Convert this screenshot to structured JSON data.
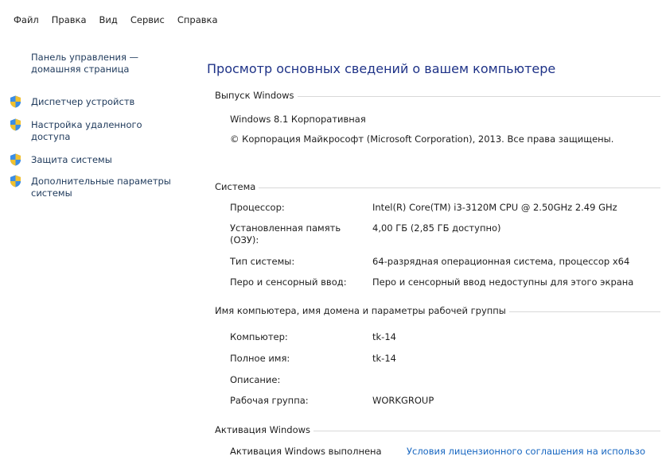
{
  "menu": {
    "items": [
      "Файл",
      "Правка",
      "Вид",
      "Сервис",
      "Справка"
    ]
  },
  "sidebar": {
    "home_link": "Панель управления — домашняя страница",
    "links": [
      {
        "label": "Диспетчер устройств",
        "icon": "uac-shield-icon"
      },
      {
        "label": "Настройка удаленного доступа",
        "icon": "uac-shield-icon"
      },
      {
        "label": "Защита системы",
        "icon": "uac-shield-icon"
      },
      {
        "label": "Дополнительные параметры системы",
        "icon": "uac-shield-icon"
      }
    ]
  },
  "main": {
    "title": "Просмотр основных сведений о вашем компьютере",
    "edition": {
      "header": "Выпуск Windows",
      "name": "Windows 8.1 Корпоративная",
      "copyright": "© Корпорация Майкрософт (Microsoft Corporation), 2013. Все права защищены."
    },
    "system": {
      "header": "Система",
      "rows": [
        {
          "label": "Процессор:",
          "value": "Intel(R) Core(TM) i3-3120M CPU @ 2.50GHz   2.49 GHz"
        },
        {
          "label": "Установленная память (ОЗУ):",
          "value": "4,00 ГБ (2,85 ГБ доступно)"
        },
        {
          "label": "Тип системы:",
          "value": "64-разрядная операционная система, процессор x64"
        },
        {
          "label": "Перо и сенсорный ввод:",
          "value": "Перо и сенсорный ввод недоступны для этого экрана"
        }
      ]
    },
    "computer": {
      "header": "Имя компьютера, имя домена и параметры рабочей группы",
      "rows": [
        {
          "label": "Компьютер:",
          "value": "tk-14"
        },
        {
          "label": "Полное имя:",
          "value": "tk-14"
        },
        {
          "label": "Описание:",
          "value": ""
        },
        {
          "label": "Рабочая группа:",
          "value": "WORKGROUP"
        }
      ]
    },
    "activation": {
      "header": "Активация Windows",
      "status": "Активация Windows выполнена",
      "license_link": "Условия лицензионного соглашения на использо"
    }
  },
  "colors": {
    "link": "#1e395b",
    "title": "#1e3287",
    "hyperlink": "#1565c0"
  }
}
